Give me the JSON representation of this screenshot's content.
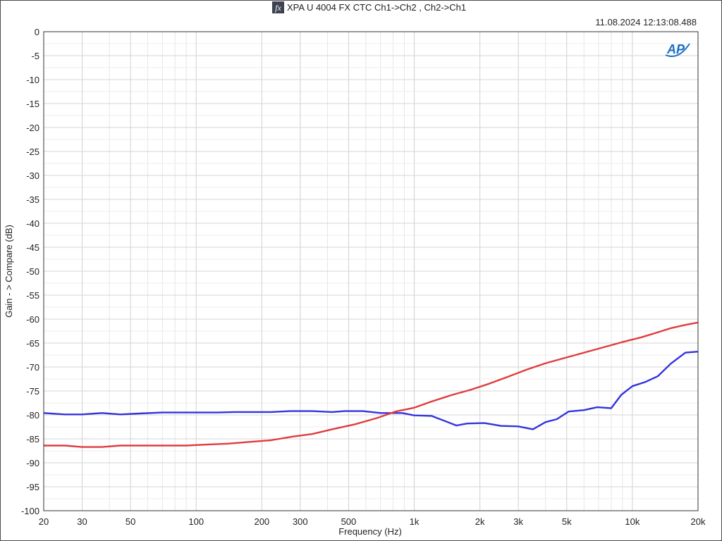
{
  "header": {
    "title": "XPA U 4004 FX CTC Ch1->Ch2 , Ch2->Ch1",
    "timestamp": "11.08.2024 12:13:08.488",
    "fx_icon": "fx-icon",
    "fx_glyph": "fx",
    "logo_text": "AP",
    "logo_icon": "ap-logo-icon"
  },
  "chart_data": {
    "type": "line",
    "title": "XPA U 4004 FX CTC Ch1->Ch2 , Ch2->Ch1",
    "xlabel": "Frequency (Hz)",
    "ylabel": "Gain - > Compare (dB)",
    "xscale": "log",
    "xlim": [
      20,
      20000
    ],
    "ylim": [
      -100,
      0
    ],
    "grid": true,
    "x_ticks": [
      {
        "value": 20,
        "label": "20"
      },
      {
        "value": 30,
        "label": "30"
      },
      {
        "value": 50,
        "label": "50"
      },
      {
        "value": 100,
        "label": "100"
      },
      {
        "value": 200,
        "label": "200"
      },
      {
        "value": 300,
        "label": "300"
      },
      {
        "value": 500,
        "label": "500"
      },
      {
        "value": 1000,
        "label": "1k"
      },
      {
        "value": 2000,
        "label": "2k"
      },
      {
        "value": 3000,
        "label": "3k"
      },
      {
        "value": 5000,
        "label": "5k"
      },
      {
        "value": 10000,
        "label": "10k"
      },
      {
        "value": 20000,
        "label": "20k"
      }
    ],
    "y_ticks": [
      {
        "value": 0,
        "label": "0"
      },
      {
        "value": -5,
        "label": "-5"
      },
      {
        "value": -10,
        "label": "-10"
      },
      {
        "value": -15,
        "label": "-15"
      },
      {
        "value": -20,
        "label": "-20"
      },
      {
        "value": -25,
        "label": "-25"
      },
      {
        "value": -30,
        "label": "-30"
      },
      {
        "value": -35,
        "label": "-35"
      },
      {
        "value": -40,
        "label": "-40"
      },
      {
        "value": -45,
        "label": "-45"
      },
      {
        "value": -50,
        "label": "-50"
      },
      {
        "value": -55,
        "label": "-55"
      },
      {
        "value": -60,
        "label": "-60"
      },
      {
        "value": -65,
        "label": "-65"
      },
      {
        "value": -70,
        "label": "-70"
      },
      {
        "value": -75,
        "label": "-75"
      },
      {
        "value": -80,
        "label": "-80"
      },
      {
        "value": -85,
        "label": "-85"
      },
      {
        "value": -90,
        "label": "-90"
      },
      {
        "value": -95,
        "label": "-95"
      },
      {
        "value": -100,
        "label": "-100"
      }
    ],
    "series": [
      {
        "color": "#3333dd",
        "x": [
          20,
          25,
          30,
          37,
          45,
          55,
          70,
          90,
          125,
          150,
          220,
          270,
          340,
          420,
          480,
          580,
          700,
          880,
          1000,
          1200,
          1560,
          1750,
          2100,
          2500,
          3000,
          3500,
          4000,
          4500,
          5100,
          6000,
          6900,
          8000,
          8900,
          10000,
          11500,
          13100,
          15000,
          17500,
          20000
        ],
        "y": [
          -79.6,
          -79.9,
          -79.9,
          -79.6,
          -79.9,
          -79.7,
          -79.5,
          -79.5,
          -79.5,
          -79.4,
          -79.4,
          -79.2,
          -79.2,
          -79.4,
          -79.2,
          -79.2,
          -79.6,
          -79.6,
          -80.1,
          -80.2,
          -82.2,
          -81.8,
          -81.7,
          -82.3,
          -82.4,
          -83.0,
          -81.5,
          -80.9,
          -79.3,
          -79.0,
          -78.4,
          -78.6,
          -75.8,
          -74.0,
          -73.1,
          -71.9,
          -69.3,
          -67.0,
          -66.8
        ]
      },
      {
        "color": "#e03c3c",
        "x": [
          20,
          25,
          30,
          37,
          45,
          55,
          70,
          90,
          110,
          140,
          180,
          220,
          280,
          340,
          420,
          530,
          680,
          820,
          1000,
          1200,
          1500,
          1800,
          2200,
          2700,
          3300,
          4000,
          5000,
          6000,
          7500,
          9000,
          11000,
          13000,
          15000,
          17500,
          20000
        ],
        "y": [
          -86.4,
          -86.4,
          -86.7,
          -86.7,
          -86.4,
          -86.4,
          -86.4,
          -86.4,
          -86.2,
          -86.0,
          -85.6,
          -85.3,
          -84.5,
          -84.0,
          -83.0,
          -82.0,
          -80.6,
          -79.3,
          -78.5,
          -77.2,
          -75.8,
          -74.8,
          -73.5,
          -72.0,
          -70.5,
          -69.2,
          -68.0,
          -67.0,
          -65.8,
          -64.8,
          -63.8,
          -62.8,
          -61.9,
          -61.2,
          -60.7
        ]
      }
    ]
  }
}
